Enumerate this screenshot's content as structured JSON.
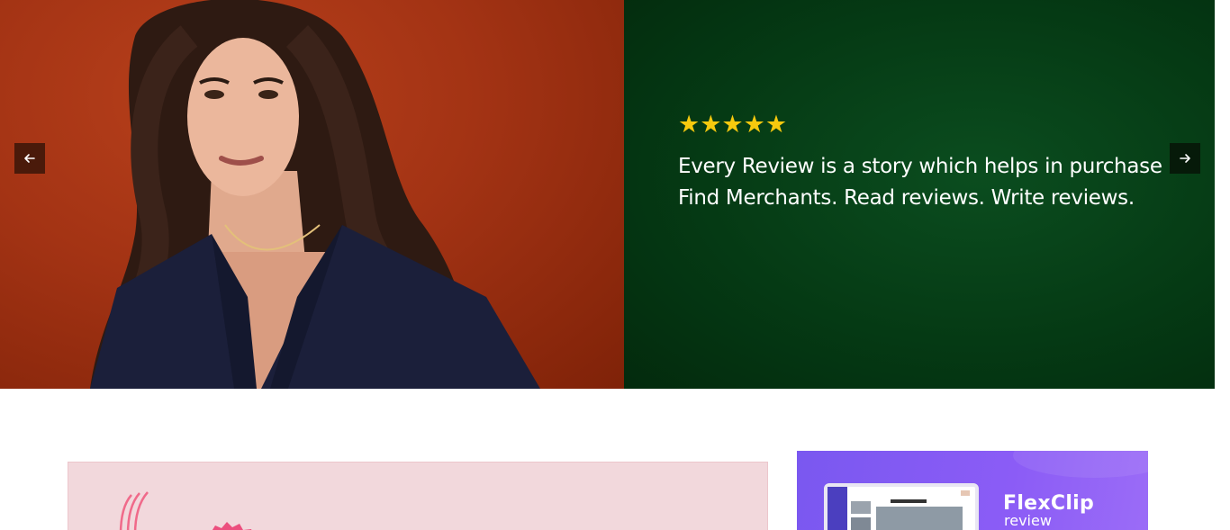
{
  "hero": {
    "stars": "★★★★★",
    "rating": 5,
    "line1": "Every Review is a story which helps in purchase",
    "line2": "Find Merchants. Read reviews. Write reviews.",
    "colors": {
      "photo_bg": "#a33314",
      "panel_bg": "#053a14",
      "stars": "#f6c90e"
    },
    "prev_icon": "arrow-left-icon",
    "next_icon": "arrow-right-icon"
  },
  "promo": {
    "title": "FlexClip",
    "subtitle": "review",
    "color": "#8b5cf6"
  },
  "feature_card": {
    "color": "#f2d8dc"
  }
}
